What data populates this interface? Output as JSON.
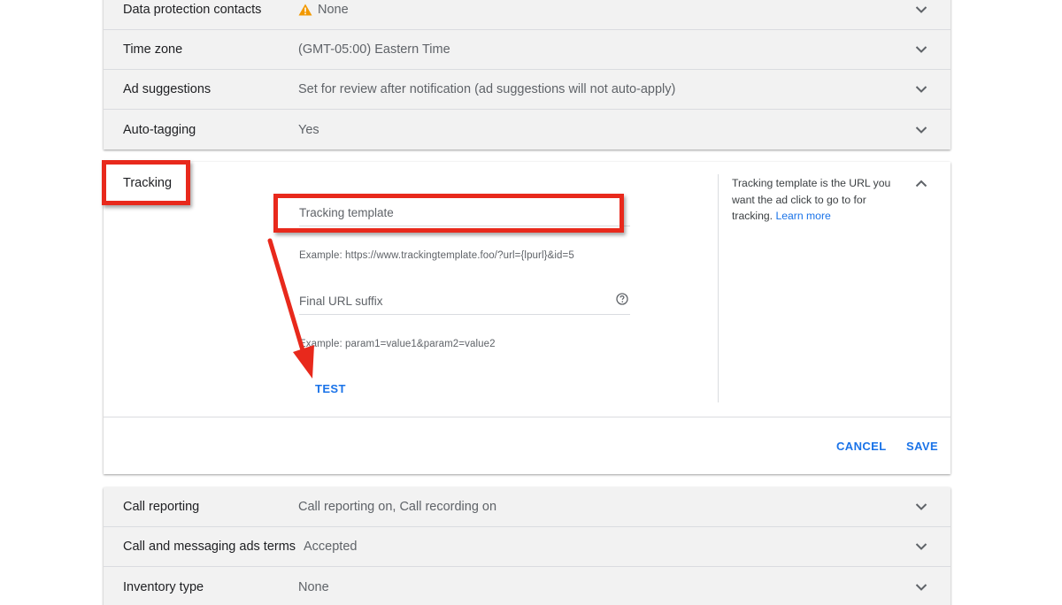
{
  "top_settings": [
    {
      "label": "Data protection contacts",
      "value": "None",
      "warning": true
    },
    {
      "label": "Time zone",
      "value": "(GMT-05:00) Eastern Time"
    },
    {
      "label": "Ad suggestions",
      "value": "Set for review after notification (ad suggestions will not auto-apply)"
    },
    {
      "label": "Auto-tagging",
      "value": "Yes"
    }
  ],
  "tracking": {
    "title": "Tracking",
    "template_placeholder": "Tracking template",
    "template_example": "Example: https://www.trackingtemplate.foo/?url={lpurl}&id=5",
    "suffix_placeholder": "Final URL suffix",
    "suffix_example": "Example: param1=value1&param2=value2",
    "test_label": "TEST",
    "help_text": "Tracking template is the URL you want the ad click to go to for tracking.",
    "learn_more": "Learn more",
    "cancel_label": "CANCEL",
    "save_label": "SAVE"
  },
  "bottom_settings": [
    {
      "label": "Call reporting",
      "value": "Call reporting on, Call recording on"
    },
    {
      "label": "Call and messaging ads terms",
      "value": "Accepted"
    },
    {
      "label": "Inventory type",
      "value": "None"
    }
  ],
  "colors": {
    "accent": "#1a73e8",
    "annotation": "#e8291c",
    "warning": "#f29900"
  },
  "icons": {
    "warning": "warning-triangle-icon",
    "expand": "chevron-down-icon",
    "collapse": "chevron-up-icon",
    "help": "help-circle-icon"
  }
}
